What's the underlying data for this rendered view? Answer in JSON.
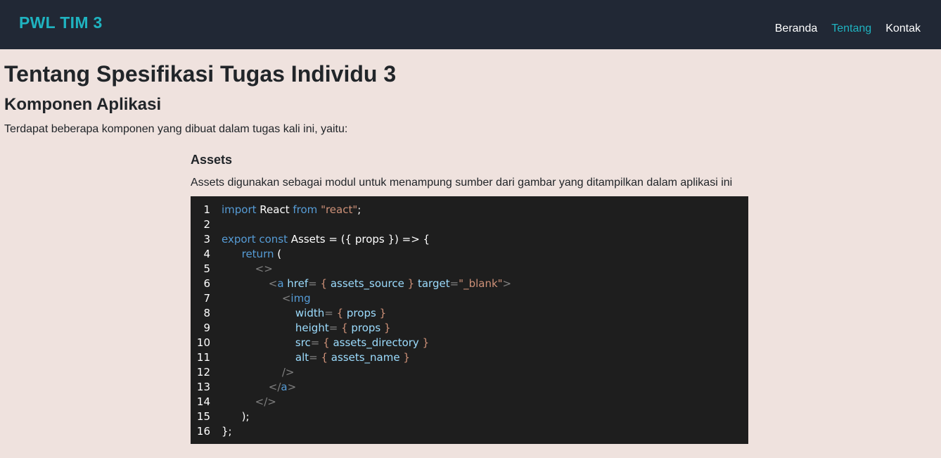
{
  "navbar": {
    "brand": "PWL TIM 3",
    "links": [
      {
        "label": "Beranda",
        "active": false
      },
      {
        "label": "Tentang",
        "active": true
      },
      {
        "label": "Kontak",
        "active": false
      }
    ]
  },
  "page": {
    "title": "Tentang Spesifikasi Tugas Individu 3",
    "section_title": "Komponen Aplikasi",
    "intro": "Terdapat beberapa komponen yang dibuat dalam tugas kali ini, yaitu:",
    "component": {
      "title": "Assets",
      "description": "Assets digunakan sebagai modul untuk menampung sumber dari gambar yang ditampilkan dalam aplikasi ini"
    }
  },
  "code": {
    "line_numbers": [
      "1",
      "2",
      "3",
      "4",
      "5",
      "6",
      "7",
      "8",
      "9",
      "10",
      "11",
      "12",
      "13",
      "14",
      "15",
      "16"
    ],
    "lines": [
      [
        {
          "t": "import",
          "c": "kw"
        },
        {
          "t": " React ",
          "c": "id"
        },
        {
          "t": "from",
          "c": "kw"
        },
        {
          "t": " \"react\"",
          "c": "str"
        },
        {
          "t": ";",
          "c": "id"
        }
      ],
      [],
      [
        {
          "t": "export",
          "c": "kw"
        },
        {
          "t": " const",
          "c": "kw"
        },
        {
          "t": " Assets = ({ props }) => {",
          "c": "id"
        }
      ],
      [
        {
          "t": "      return",
          "c": "kw"
        },
        {
          "t": " (",
          "c": "id"
        }
      ],
      [
        {
          "t": "          <>",
          "c": "tag"
        }
      ],
      [
        {
          "t": "              <",
          "c": "tag"
        },
        {
          "t": "a",
          "c": "tagname"
        },
        {
          "t": " href",
          "c": "attr"
        },
        {
          "t": "= ",
          "c": "tag"
        },
        {
          "t": "{",
          "c": "str"
        },
        {
          "t": " assets_source ",
          "c": "attr"
        },
        {
          "t": "}",
          "c": "str"
        },
        {
          "t": " target",
          "c": "attr"
        },
        {
          "t": "=",
          "c": "tag"
        },
        {
          "t": "\"_blank\"",
          "c": "str"
        },
        {
          "t": ">",
          "c": "tag"
        }
      ],
      [
        {
          "t": "                  <",
          "c": "tag"
        },
        {
          "t": "img",
          "c": "tagname"
        }
      ],
      [
        {
          "t": "                      width",
          "c": "attr"
        },
        {
          "t": "= ",
          "c": "tag"
        },
        {
          "t": "{",
          "c": "str"
        },
        {
          "t": " props ",
          "c": "attr"
        },
        {
          "t": "}",
          "c": "str"
        }
      ],
      [
        {
          "t": "                      height",
          "c": "attr"
        },
        {
          "t": "= ",
          "c": "tag"
        },
        {
          "t": "{",
          "c": "str"
        },
        {
          "t": " props ",
          "c": "attr"
        },
        {
          "t": "}",
          "c": "str"
        }
      ],
      [
        {
          "t": "                      src",
          "c": "attr"
        },
        {
          "t": "= ",
          "c": "tag"
        },
        {
          "t": "{",
          "c": "str"
        },
        {
          "t": " assets_directory ",
          "c": "attr"
        },
        {
          "t": "}",
          "c": "str"
        }
      ],
      [
        {
          "t": "                      alt",
          "c": "attr"
        },
        {
          "t": "= ",
          "c": "tag"
        },
        {
          "t": "{",
          "c": "str"
        },
        {
          "t": " assets_name ",
          "c": "attr"
        },
        {
          "t": "}",
          "c": "str"
        }
      ],
      [
        {
          "t": "                  />",
          "c": "tag"
        }
      ],
      [
        {
          "t": "              </",
          "c": "tag"
        },
        {
          "t": "a",
          "c": "tagname"
        },
        {
          "t": ">",
          "c": "tag"
        }
      ],
      [
        {
          "t": "          </>",
          "c": "tag"
        }
      ],
      [
        {
          "t": "      );",
          "c": "id"
        }
      ],
      [
        {
          "t": "};",
          "c": "id"
        }
      ]
    ]
  }
}
